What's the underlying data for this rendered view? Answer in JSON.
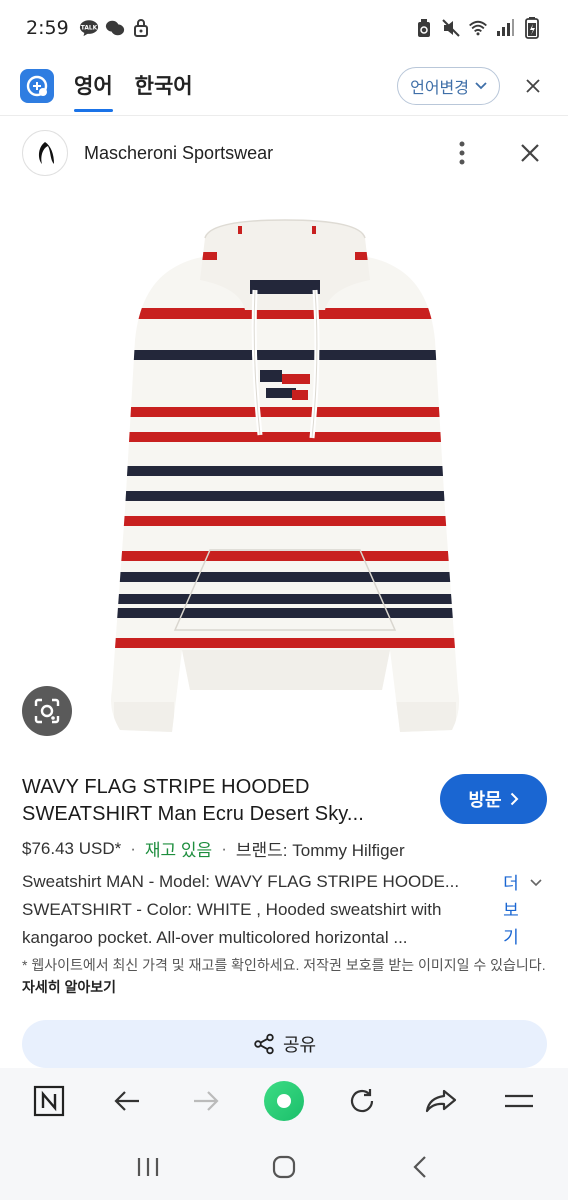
{
  "status_bar": {
    "time": "2:59",
    "talk_badge": "TALK",
    "left_icons": [
      "talk-icon",
      "chat-bubble-icon",
      "lock-icon"
    ],
    "right_icons": [
      "recycle-icon",
      "mute-icon",
      "wifi-icon",
      "signal-icon",
      "battery-icon"
    ]
  },
  "translate_bar": {
    "tabs": [
      {
        "label": "영어",
        "active": true
      },
      {
        "label": "한국어",
        "active": false
      }
    ],
    "change_label": "언어변경"
  },
  "source": {
    "name": "Mascheroni Sportswear"
  },
  "product": {
    "title_line1": "WAVY FLAG STRIPE HOODED",
    "title_line2": "SWEATSHIRT Man Ecru Desert Sky...",
    "visit_label": "방문",
    "price": "$76.43 USD*",
    "stock": "재고 있음",
    "brand": "브랜드: Tommy Hilfiger",
    "desc_line1": "Sweatshirt MAN - Model: WAVY FLAG STRIPE HOODE...",
    "desc_line2": "SWEATSHIRT - Color: WHITE , Hooded sweatshirt with",
    "desc_line3": "kangaroo pocket. All-over multicolored horizontal ...",
    "more_label": "더보기",
    "disclaimer": "* 웹사이트에서 최신 가격 및 재고를 확인하세요. 저작권 보호를 받는 이미지일 수 있습니다.",
    "learn_more": "자세히 알아보기",
    "share_label": "공유"
  },
  "colors": {
    "accent": "#1a66d2",
    "stock_green": "#1e8e3e",
    "stripe_red": "#c8201f",
    "stripe_navy": "#23273a",
    "sweater": "#f7f6f2"
  }
}
